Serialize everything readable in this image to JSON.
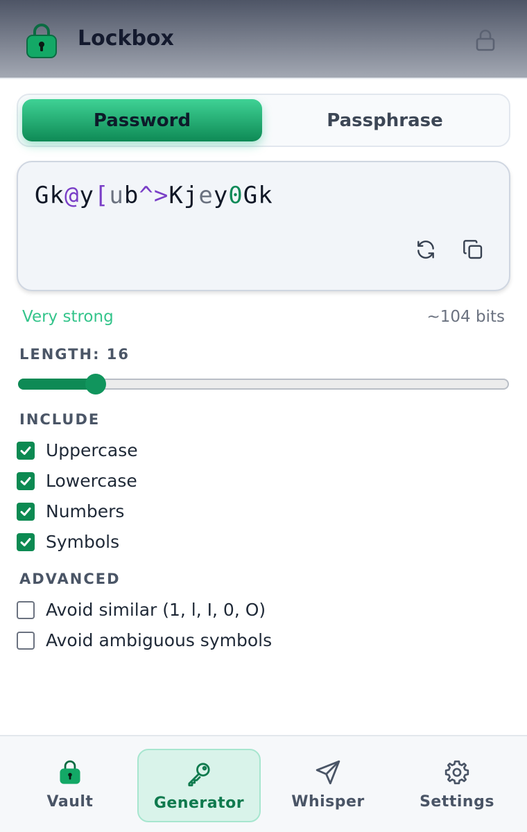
{
  "app": {
    "title": "Lockbox",
    "logo_icon": "green-lock-icon",
    "lock_icon": "padlock-icon"
  },
  "mode_tabs": [
    {
      "label": "Password",
      "active": true
    },
    {
      "label": "Passphrase",
      "active": false
    }
  ],
  "generated": {
    "password": "Gk@y[ub^>Kjey0Gk",
    "refresh_icon": "refresh-icon",
    "copy_icon": "copy-icon"
  },
  "strength": {
    "label": "Very strong",
    "bits": "~104 bits",
    "color": "#34c48b"
  },
  "length": {
    "label": "LENGTH: 16",
    "value": 16,
    "fraction": 0.16
  },
  "include": {
    "heading": "INCLUDE",
    "options": [
      {
        "label": "Uppercase",
        "checked": true
      },
      {
        "label": "Lowercase",
        "checked": true
      },
      {
        "label": "Numbers",
        "checked": true
      },
      {
        "label": "Symbols",
        "checked": true
      }
    ]
  },
  "advanced": {
    "heading": "ADVANCED",
    "options": [
      {
        "label": "Avoid similar (1, l, I, 0, O)",
        "checked": false
      },
      {
        "label": "Avoid ambiguous symbols",
        "checked": false
      }
    ]
  },
  "nav": [
    {
      "label": "Vault",
      "icon": "green-lock-icon",
      "active": false
    },
    {
      "label": "Generator",
      "icon": "key-icon",
      "active": true
    },
    {
      "label": "Whisper",
      "icon": "send-icon",
      "active": false
    },
    {
      "label": "Settings",
      "icon": "gear-icon",
      "active": false
    }
  ],
  "colors": {
    "accent": "#0e8a55",
    "accent_light": "#3fd295",
    "symbol": "#7a3fc7"
  }
}
